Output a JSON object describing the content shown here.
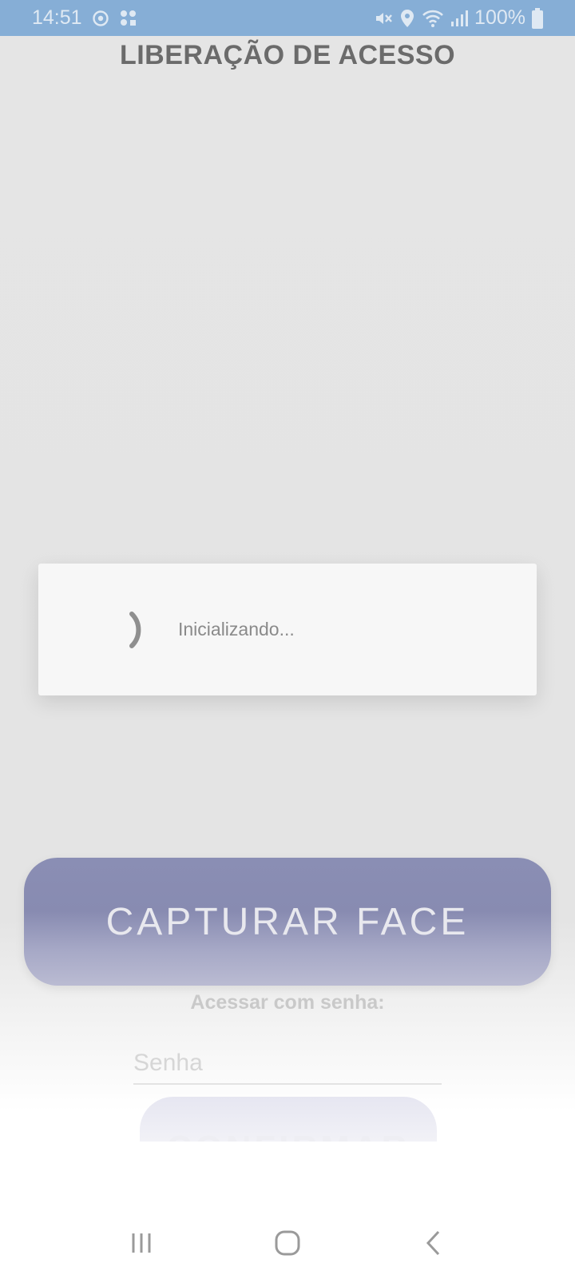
{
  "status_bar": {
    "time": "14:51",
    "battery": "100%",
    "icons": [
      "sync-icon",
      "apps-icon",
      "mute-icon",
      "location-icon",
      "wifi-icon",
      "signal-icon",
      "battery-icon"
    ]
  },
  "header": {
    "title": "LIBERAÇÃO DE ACESSO"
  },
  "loading_dialog": {
    "message": "Inicializando...",
    "icon": "spinner-icon"
  },
  "main": {
    "capture_button_label": "CAPTURAR FACE",
    "password_label": "Acessar com senha:",
    "password_placeholder": "Senha",
    "password_value": "",
    "confirm_button_label": "CONFIRMAR"
  },
  "nav_bar": {
    "icons": [
      "recent-apps-icon",
      "home-icon",
      "back-icon"
    ]
  },
  "colors": {
    "status_bar": "#86aed6",
    "capture_button": "#888bb1",
    "title": "#6b6b6b"
  }
}
